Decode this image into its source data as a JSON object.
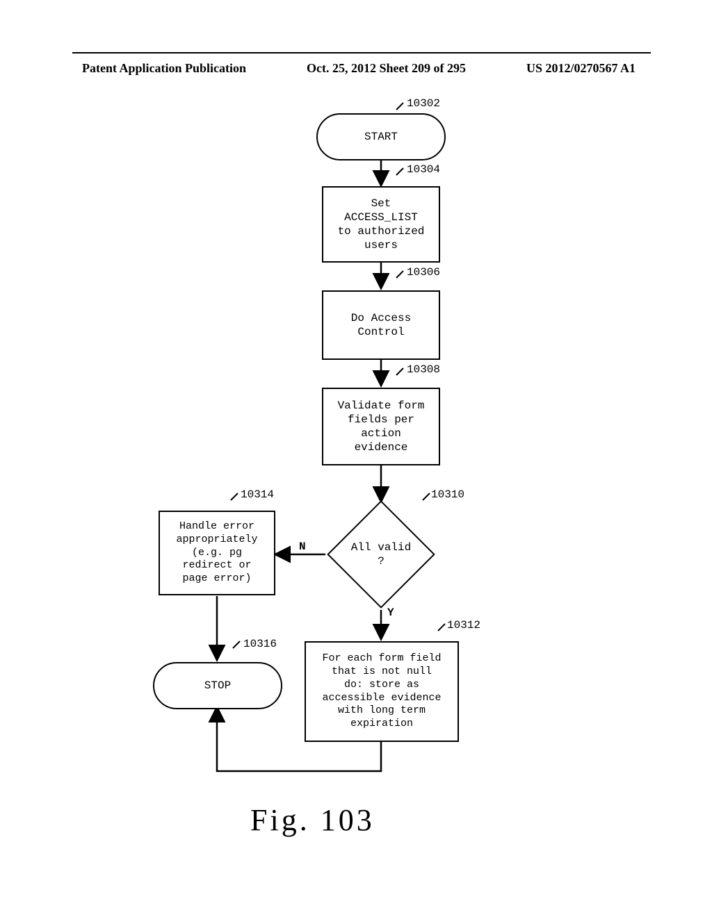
{
  "header": {
    "left": "Patent Application Publication",
    "center": "Oct. 25, 2012 Sheet 209 of 295",
    "right": "US 2012/0270567 A1"
  },
  "nodes": {
    "start": {
      "label": "START",
      "ref": "10302"
    },
    "setAccess": {
      "label": "Set\nACCESS_LIST\nto authorized\nusers",
      "ref": "10304"
    },
    "doAccess": {
      "label": "Do Access\nControl",
      "ref": "10306"
    },
    "validate": {
      "label": "Validate form\nfields per\naction\nevidence",
      "ref": "10308"
    },
    "decision": {
      "label": "All valid ?",
      "ref": "10310"
    },
    "store": {
      "label": "For each form field\nthat is not null\ndo: store as\naccessible evidence\nwith long term\nexpiration",
      "ref": "10312"
    },
    "handleError": {
      "label": "Handle error\nappropriately\n(e.g. pg\nredirect or\npage error)",
      "ref": "10314"
    },
    "stop": {
      "label": "STOP",
      "ref": "10316"
    }
  },
  "edges": {
    "no": "N",
    "yes": "Y"
  },
  "figure": "Fig. 103"
}
